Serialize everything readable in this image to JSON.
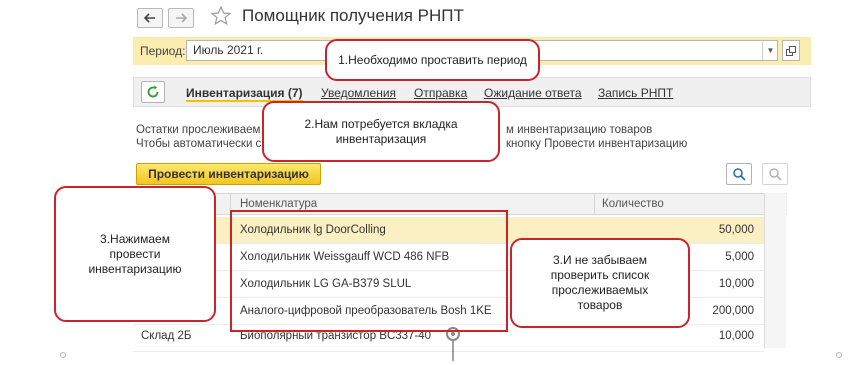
{
  "window": {
    "title": "Помощник получения РНПТ"
  },
  "period": {
    "label": "Период:",
    "value": "Июль 2021 г."
  },
  "tabs": [
    {
      "label": "Инвентаризация (7)",
      "active": true
    },
    {
      "label": "Уведомления",
      "active": false
    },
    {
      "label": "Отправка",
      "active": false
    },
    {
      "label": "Ожидание ответа",
      "active": false
    },
    {
      "label": "Запись РНПТ",
      "active": false
    }
  ],
  "info": {
    "line1_start": "Остатки прослеживаем",
    "line1_end": "м инвентаризацию товаров",
    "line2_start": "Чтобы автоматически с",
    "line2_end": "кнопку Провести инвентаризацию"
  },
  "actions": {
    "run_inventory": "Провести инвентаризацию"
  },
  "table": {
    "columns": [
      "Номенклатура",
      "Количество"
    ],
    "rows": [
      {
        "warehouse": "",
        "item": "Холодильник lg DoorColling",
        "qty": "50,000",
        "selected": true
      },
      {
        "warehouse": "",
        "item": "Холодильник Weissgauff WCD 486 NFB",
        "qty": "5,000",
        "selected": false
      },
      {
        "warehouse": "",
        "item": "Холодильник LG GA-B379 SLUL",
        "qty": "10,000",
        "selected": false
      },
      {
        "warehouse": "",
        "item": "Аналого-цифровой преобразователь Bosh 1KE",
        "qty": "200,000",
        "selected": false
      },
      {
        "warehouse": "Склад 2Б",
        "item": "Биополярный транзистор BC337-40",
        "qty": "10,000",
        "selected": false
      }
    ]
  },
  "callouts": {
    "c1": "1.Необходимо проставить период",
    "c2": "2.Нам потребуется  вкладка инвентаризация",
    "c3a": "3.Нажимаем провести инвентаризацию",
    "c3b": "3.И не забываем проверить список прослеживаемых товаров"
  },
  "colors": {
    "accent_yellow": "#f3c620",
    "period_bg": "#fbedb0",
    "callout_border": "#c8242a",
    "selected_row": "#fbf0c3"
  }
}
